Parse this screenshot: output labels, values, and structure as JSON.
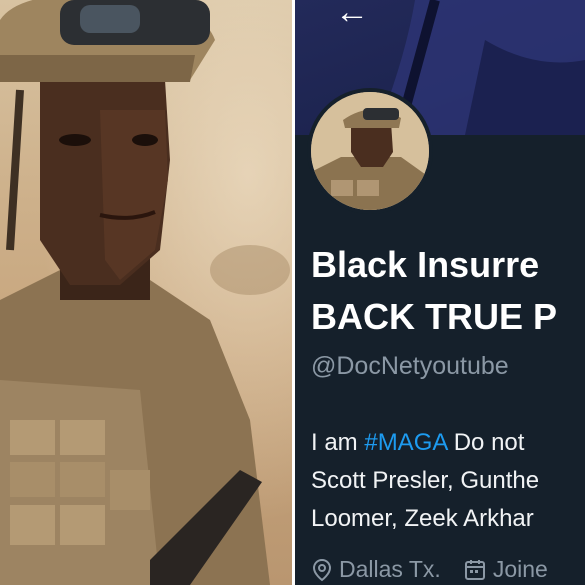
{
  "profile": {
    "back_icon": "arrow-left-icon",
    "name_line1": "Black Insurre",
    "name_line2": "BACK TRUE P",
    "handle": "@DocNetyoutube",
    "bio": {
      "prefix": "I am ",
      "hashtag": "#MAGA",
      "after_hashtag": " Do not",
      "line2": "Scott Presler, Gunthe",
      "line3": "Loomer, Zeek Arkhar"
    },
    "location": "Dallas Tx.",
    "joined": "Joine",
    "colors": {
      "background": "#15202b",
      "hashtag": "#1d9bf0",
      "muted": "#8b98a5"
    }
  }
}
